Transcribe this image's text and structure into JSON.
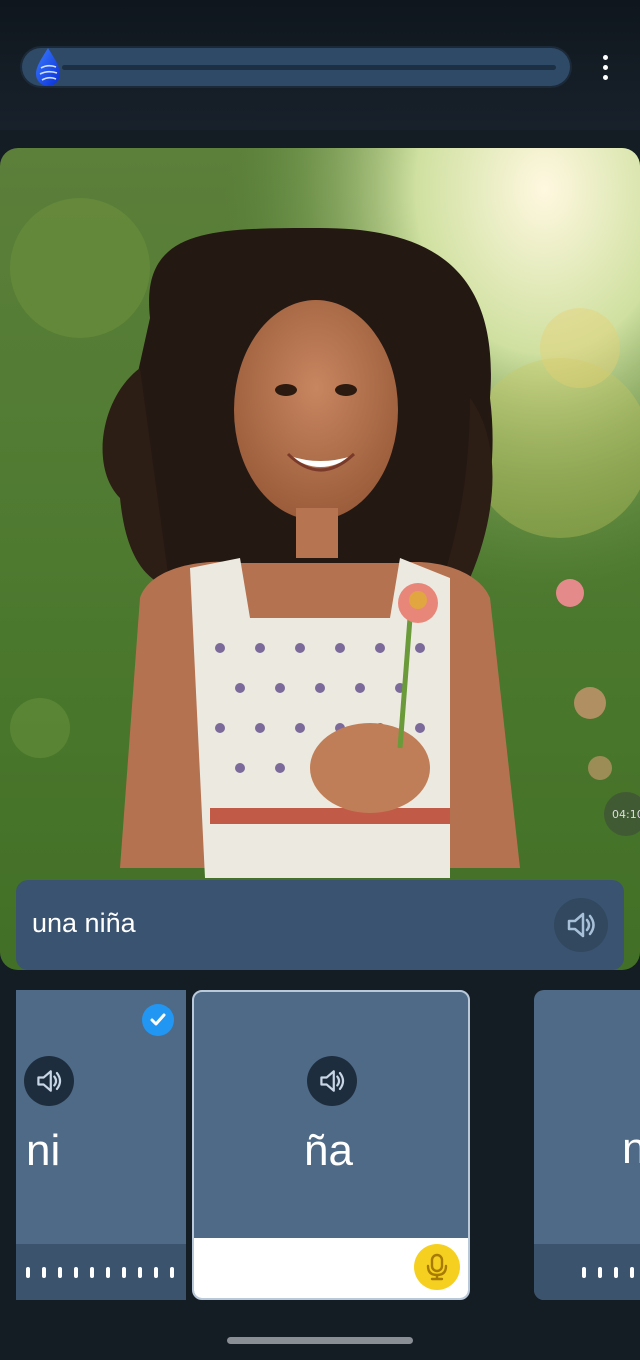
{
  "caption": {
    "text": "una niña"
  },
  "timestamp": "04:10",
  "cards": [
    {
      "syllable": "ni",
      "status": "completed"
    },
    {
      "syllable": "ña",
      "status": "active"
    },
    {
      "syllable": "n",
      "status": "upcoming"
    }
  ],
  "icons": {
    "progress_knob": "water-drop-icon",
    "menu": "more-vertical-icon",
    "audio": "speaker-icon",
    "check": "check-icon",
    "mic": "microphone-icon"
  },
  "colors": {
    "accent_blue": "#2196f3",
    "mic_yellow": "#f5d020",
    "card_bg": "#4f6a86"
  }
}
